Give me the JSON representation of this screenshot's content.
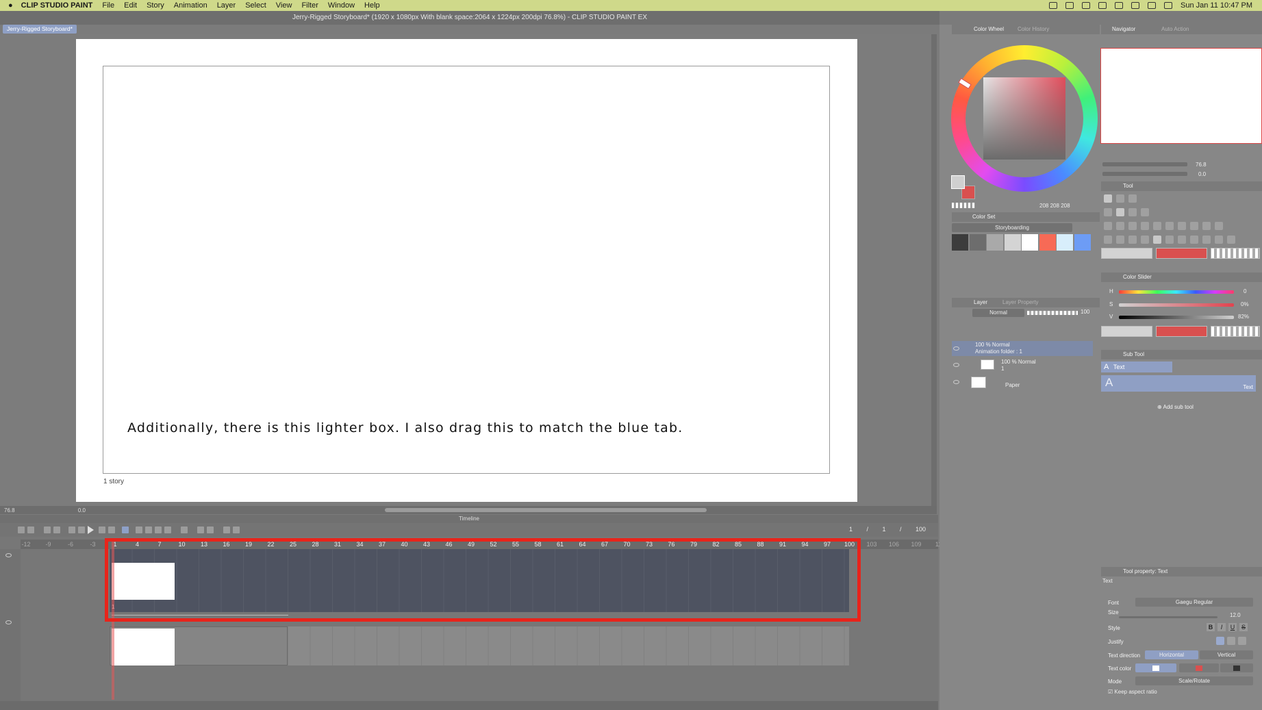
{
  "menubar": {
    "app_name": "CLIP STUDIO PAINT",
    "items": [
      "File",
      "Edit",
      "Story",
      "Animation",
      "Layer",
      "Select",
      "View",
      "Filter",
      "Window",
      "Help"
    ],
    "clock": "Sun Jan 11  10:47 PM"
  },
  "window": {
    "title": "Jerry-Rigged Storyboard* (1920 x 1080px With blank space:2064 x 1224px 200dpi 76.8%)  - CLIP STUDIO PAINT EX",
    "doc_tab": "Jerry-Rigged Storyboard*"
  },
  "canvas": {
    "caption": "Additionally, there is this lighter box. I also drag this to match the blue tab.",
    "story_label": "1 story",
    "zoom_readout": "76.8",
    "rotate_readout": "0.0"
  },
  "timeline": {
    "title": "Timeline",
    "frame_counter": "1 / 1 / 100",
    "ruler_neg": [
      "-12",
      "-9",
      "-6",
      "-3"
    ],
    "ruler": [
      "1",
      "4",
      "7",
      "10",
      "13",
      "16",
      "19",
      "22",
      "25",
      "28",
      "31",
      "34",
      "37",
      "40",
      "43",
      "46",
      "49",
      "52",
      "55",
      "58",
      "61",
      "64",
      "67",
      "70",
      "73",
      "76",
      "79",
      "82",
      "85",
      "88",
      "91",
      "94",
      "97",
      "100"
    ],
    "ruler_after": [
      "103",
      "106",
      "109",
      "11"
    ],
    "cel_number": "1"
  },
  "color_wheel": {
    "tab": "Color Wheel",
    "tab2": "Color History",
    "values": [
      "208",
      "208",
      "208"
    ]
  },
  "color_set": {
    "tab": "Color Set",
    "set_name": "Storyboarding",
    "swatches": [
      "#3c3c3c",
      "#6d6d6d",
      "#a9a9a9",
      "#d4d4d4",
      "#ffffff",
      "#f76a56",
      "#d8eefb",
      "#6d9cf5"
    ]
  },
  "layer": {
    "tab": "Layer",
    "tab2": "Layer Property",
    "blend_mode": "Normal",
    "opacity": "100",
    "rows": [
      {
        "line1": "100 % Normal",
        "line2": "Animation folder : 1"
      },
      {
        "line1": "100 % Normal",
        "line2": "1"
      },
      {
        "line1": "Paper",
        "line2": ""
      }
    ]
  },
  "navigator": {
    "tab": "Navigator",
    "tab2": "Auto Action",
    "zoom": "76.8",
    "angle": "0.0"
  },
  "tool": {
    "tab": "Tool"
  },
  "color_slider": {
    "tab": "Color Slider",
    "h_value": "0",
    "s_value": "0%",
    "v_value": "82%",
    "h_label": "H",
    "s_label": "S",
    "v_label": "V"
  },
  "sub_tool": {
    "tab": "Sub Tool",
    "item": "Text",
    "big_label": "Text",
    "add_label": "Add sub tool"
  },
  "tool_property": {
    "tab": "Tool property: Text",
    "section": "Text",
    "font_label": "Font",
    "font_value": "Gaegu Regular",
    "size_label": "Size",
    "size_value": "12.0",
    "style_label": "Style",
    "justify_label": "Justify",
    "direction_label": "Text direction",
    "direction_h": "Horizontal",
    "direction_v": "Vertical",
    "text_color_label": "Text color",
    "mode_label": "Mode",
    "mode_value": "Scale/Rotate",
    "keep_aspect": "Keep aspect ratio",
    "style_buttons": [
      "B",
      "I",
      "U",
      "S"
    ]
  }
}
